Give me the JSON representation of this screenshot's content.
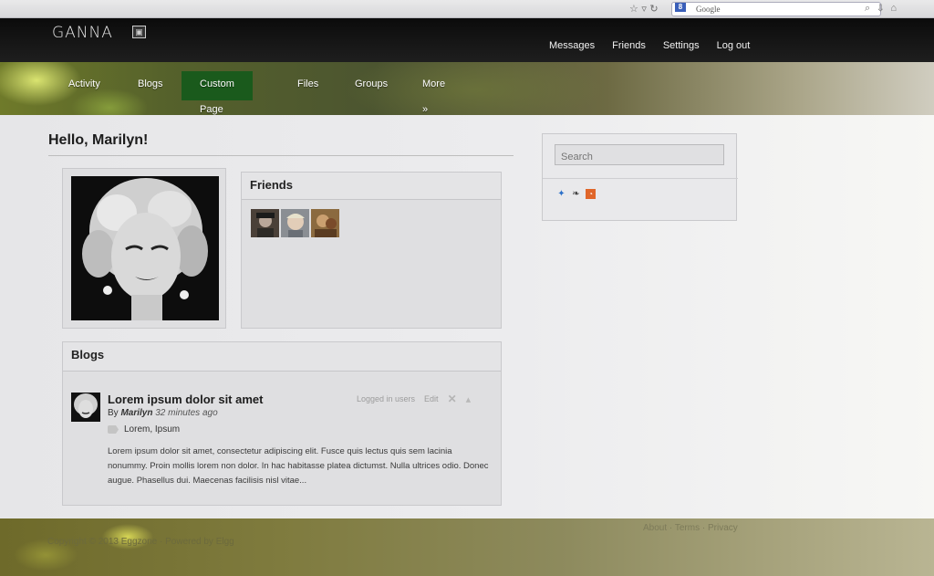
{
  "browser": {
    "search_engine_label": "Google",
    "engine_badge": "8"
  },
  "site": {
    "logo": "GANNA"
  },
  "user_nav": [
    "Messages",
    "Friends",
    "Settings",
    "Log out"
  ],
  "main_nav": {
    "items": [
      "Activity",
      "Blogs",
      "Custom Page",
      "Files",
      "Groups",
      "More »"
    ],
    "active": "Custom Page"
  },
  "greeting": "Hello, Marilyn!",
  "friends_widget": {
    "title": "Friends",
    "friend_count": 3
  },
  "search": {
    "placeholder": "Search"
  },
  "social_icons": [
    "pin-icon",
    "bird-icon",
    "rss-icon"
  ],
  "blogs_widget": {
    "title": "Blogs",
    "post": {
      "title": "Lorem ipsum dolor sit amet",
      "by_prefix": "By",
      "author": "Marilyn",
      "time": "32 minutes ago",
      "tags": "Lorem, Ipsum",
      "access": "Logged in users",
      "edit": "Edit",
      "excerpt": "Lorem ipsum dolor sit amet, consectetur adipiscing elit. Fusce quis lectus quis sem lacinia nonummy. Proin mollis lorem non dolor. In hac habitasse platea dictumst. Nulla ultrices odio. Donec augue. Phasellus dui. Maecenas facilisis nisl vitae..."
    }
  },
  "footer": {
    "copyright": "Copyright © 2013 Eggzone · Powered by Elgg",
    "links": [
      "About",
      "Terms",
      "Privacy"
    ]
  },
  "colors": {
    "topbar": "#111111",
    "active_nav": "#1a5a1c",
    "panel_bg": "#dfdfe1"
  }
}
